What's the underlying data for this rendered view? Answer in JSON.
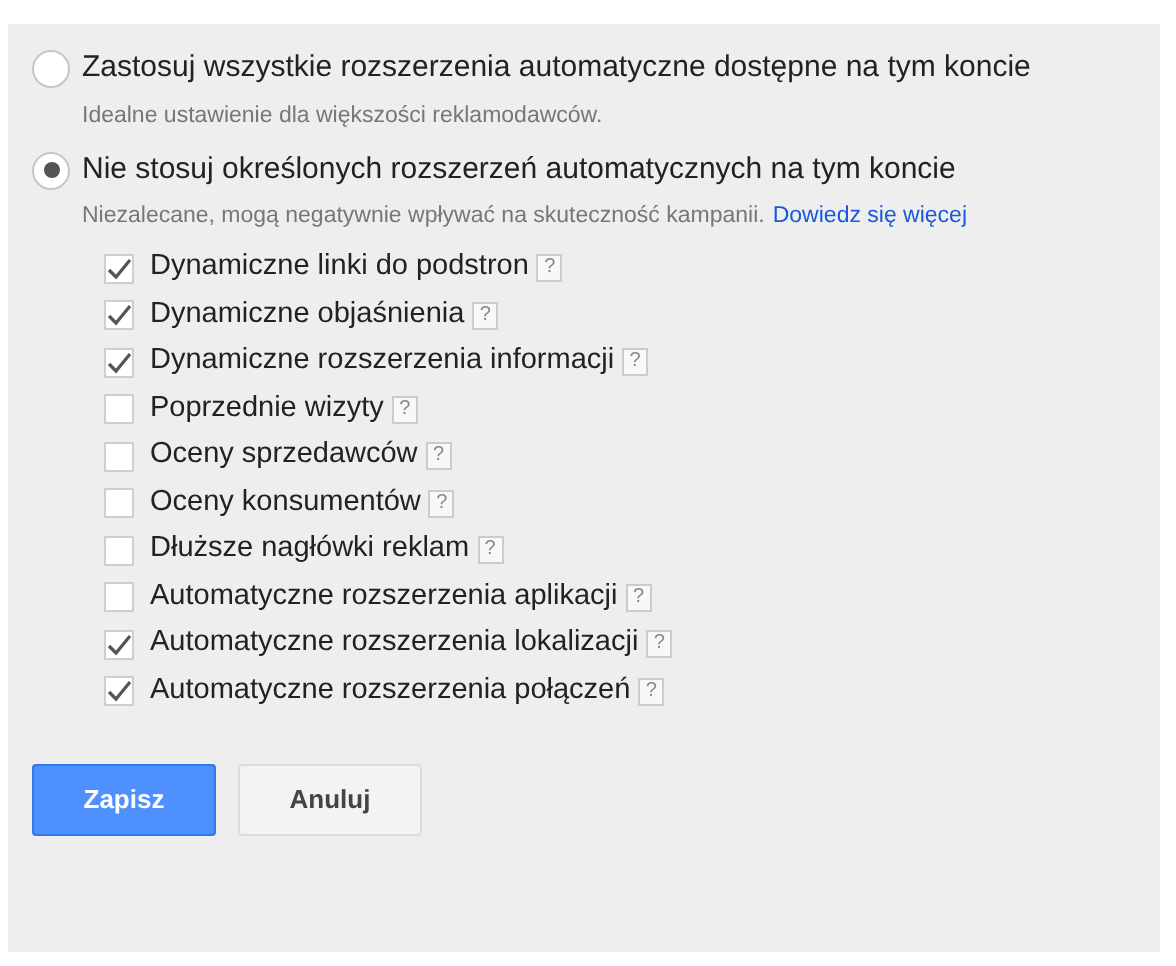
{
  "options": [
    {
      "label": "Zastosuj wszystkie rozszerzenia automatyczne dostępne na tym koncie",
      "description": "Idealne ustawienie dla większości reklamodawców.",
      "selected": false
    },
    {
      "label": "Nie stosuj określonych rozszerzeń automatycznych na tym koncie",
      "description": "Niezalecane, mogą negatywnie wpływać na skuteczność kampanii.",
      "link": "Dowiedz się więcej",
      "selected": true
    }
  ],
  "extensions": [
    {
      "label": "Dynamiczne linki do podstron",
      "help": "?",
      "checked": true
    },
    {
      "label": "Dynamiczne objaśnienia",
      "help": "?",
      "checked": true
    },
    {
      "label": "Dynamiczne rozszerzenia informacji",
      "help": "?",
      "checked": true
    },
    {
      "label": "Poprzednie wizyty",
      "help": "?",
      "checked": false
    },
    {
      "label": "Oceny sprzedawców",
      "help": "?",
      "checked": false
    },
    {
      "label": "Oceny konsumentów",
      "help": "?",
      "checked": false
    },
    {
      "label": "Dłuższe nagłówki reklam",
      "help": "?",
      "checked": false
    },
    {
      "label": "Automatyczne rozszerzenia aplikacji",
      "help": "?",
      "checked": false
    },
    {
      "label": "Automatyczne rozszerzenia lokalizacji",
      "help": "?",
      "checked": true
    },
    {
      "label": "Automatyczne rozszerzenia połączeń",
      "help": "?",
      "checked": true
    }
  ],
  "buttons": [
    {
      "label": "Zapisz",
      "kind": "primary"
    },
    {
      "label": "Anuluj",
      "kind": "secondary"
    }
  ]
}
